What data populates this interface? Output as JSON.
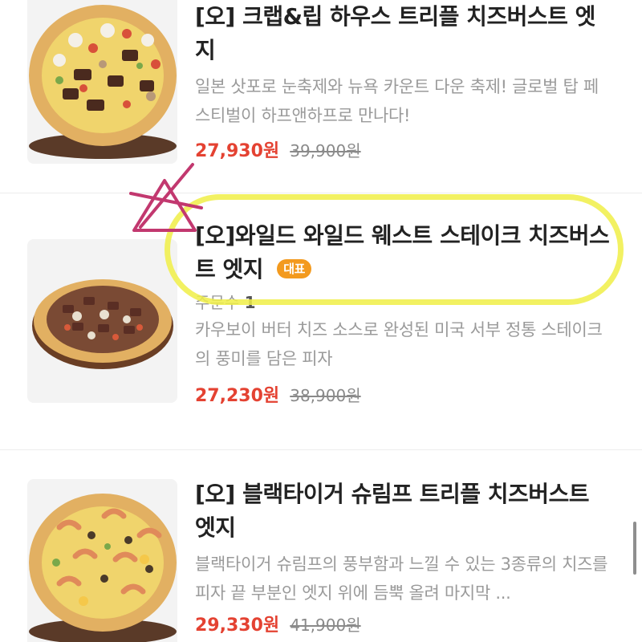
{
  "products": [
    {
      "title": "[오] 크랩&립 하우스 트리플 치즈버스트 엣지",
      "description": "일본 삿포로 눈축제와 뉴욕 카운트 다운 축제! 글로벌 탑 페스티벌이 하프앤하프로 만나다!",
      "sale_price": "27,930원",
      "original_price": "39,900원",
      "image_icon": "pizza-crab-rib-icon"
    },
    {
      "title": "[오]와일드 와일드 웨스트 스테이크 치즈버스트 엣지",
      "badge": "대표",
      "orders_label": "주문수",
      "orders_count": "1",
      "description": "카우보이 버터 치즈 소스로 완성된 미국 서부 정통 스테이크의 풍미를 담은 피자",
      "sale_price": "27,230원",
      "original_price": "38,900원",
      "image_icon": "pizza-steak-icon"
    },
    {
      "title": "[오] 블랙타이거 슈림프 트리플 치즈버스트 엣지",
      "description": "블랙타이거 슈림프의 풍부함과 느낄 수 있는 3종류의 치즈를 피자 끝 부분인 엣지 위에 듬뿍 올려 마지막 ...",
      "sale_price": "29,330원",
      "original_price": "41,900원",
      "image_icon": "pizza-shrimp-icon"
    }
  ],
  "colors": {
    "price": "#e44232",
    "badge": "#f39a1e",
    "highlight": "#f0ee46",
    "doodle": "#c2386f"
  }
}
